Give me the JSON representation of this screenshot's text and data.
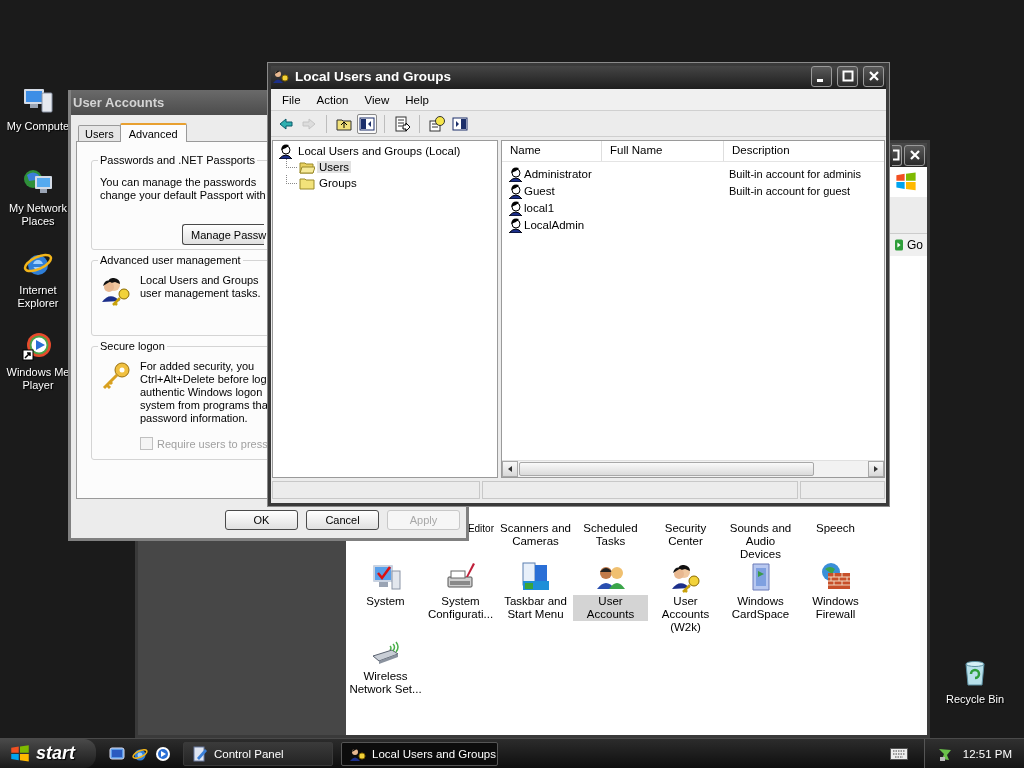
{
  "desktop_icons": [
    {
      "label": "My Compute",
      "kind": "computer"
    },
    {
      "label": "My Network Places",
      "kind": "network"
    },
    {
      "label": "Internet Explorer",
      "kind": "browser"
    },
    {
      "label": "Windows Me Player",
      "kind": "media"
    }
  ],
  "recycle_bin": {
    "label": "Recycle Bin"
  },
  "control_panel": {
    "address_button": "Go",
    "rows": [
      [
        {
          "kind": "empty"
        },
        {
          "label": "Editor",
          "kind": "partial",
          "selected": false
        },
        {
          "label": "Scanners and Cameras",
          "kind": "label",
          "selected": false
        },
        {
          "label": "Scheduled Tasks",
          "kind": "label",
          "selected": false
        },
        {
          "label": "Security Center",
          "kind": "label",
          "selected": false
        },
        {
          "label": "Sounds and Audio Devices",
          "kind": "label",
          "selected": false
        },
        {
          "label": "Speech",
          "kind": "label",
          "selected": false
        }
      ],
      [
        {
          "label": "System",
          "kind": "system",
          "selected": false
        },
        {
          "label": "System Configurati...",
          "kind": "config",
          "selected": false
        },
        {
          "label": "Taskbar and Start Menu",
          "kind": "taskbar",
          "selected": false
        },
        {
          "label": "User Accounts",
          "kind": "users",
          "selected": true
        },
        {
          "label": "User Accounts (W2k)",
          "kind": "users-key",
          "selected": false
        },
        {
          "label": "Windows CardSpace",
          "kind": "cardspace",
          "selected": false
        },
        {
          "label": "Windows Firewall",
          "kind": "firewall",
          "selected": false
        }
      ],
      [
        {
          "label": "Wireless Network Set...",
          "kind": "wireless",
          "selected": false
        }
      ]
    ]
  },
  "user_accounts": {
    "title": "User Accounts",
    "tabs": [
      {
        "label": "Users",
        "selected": false
      },
      {
        "label": "Advanced",
        "selected": true
      }
    ],
    "groups": [
      {
        "title": "Passwords and .NET Passports",
        "kind": "text",
        "lines": [
          "You can manage the passwords",
          "change your default Passport with"
        ],
        "button": "Manage Passw"
      },
      {
        "title": "Advanced user management",
        "kind": "users-key",
        "lines": [
          "Local Users and Groups",
          "user management tasks."
        ]
      },
      {
        "title": "Secure logon",
        "kind": "key",
        "lines": [
          "For added security, you",
          "Ctrl+Alt+Delete before log",
          "authentic Windows logon",
          "system from programs tha",
          "password information."
        ],
        "checkbox": {
          "label": "Require users to press",
          "checked": false,
          "disabled": true
        }
      }
    ],
    "buttons": [
      {
        "label": "OK",
        "disabled": false
      },
      {
        "label": "Cancel",
        "disabled": false
      },
      {
        "label": "Apply",
        "disabled": true
      }
    ]
  },
  "local_users": {
    "title": "Local Users and Groups",
    "menu": [
      "File",
      "Action",
      "View",
      "Help"
    ],
    "toolbar": [
      {
        "kind": "back",
        "disabled": false,
        "pressed": false
      },
      {
        "kind": "forward",
        "disabled": true,
        "pressed": false
      },
      {
        "kind": "up",
        "disabled": false,
        "pressed": false
      },
      {
        "kind": "tree",
        "disabled": false,
        "pressed": true
      },
      {
        "kind": "export",
        "disabled": false,
        "pressed": false
      },
      {
        "kind": "help",
        "disabled": false,
        "pressed": false
      },
      {
        "kind": "pane",
        "disabled": false,
        "pressed": false
      }
    ],
    "tree": [
      {
        "label": "Local Users and Groups (Local)",
        "selected": false,
        "children": [
          {
            "label": "Users",
            "selected": true
          },
          {
            "label": "Groups",
            "selected": false
          }
        ]
      }
    ],
    "columns": [
      "Name",
      "Full Name",
      "Description"
    ],
    "rows": [
      {
        "name": "Administrator",
        "description": "Built-in account for adminis"
      },
      {
        "name": "Guest",
        "description": "Built-in account for guest"
      },
      {
        "name": "local1"
      },
      {
        "name": "LocalAdmin"
      }
    ]
  },
  "taskbar": {
    "start": "start",
    "quick_launch": [
      {
        "kind": "desktop"
      },
      {
        "kind": "browser"
      },
      {
        "kind": "media"
      }
    ],
    "tasks": [
      {
        "label": "Control Panel",
        "kind": "control-panel",
        "selected": false
      },
      {
        "label": "Local Users and Groups",
        "kind": "users",
        "selected": true
      }
    ],
    "clock": "12:51 PM"
  }
}
